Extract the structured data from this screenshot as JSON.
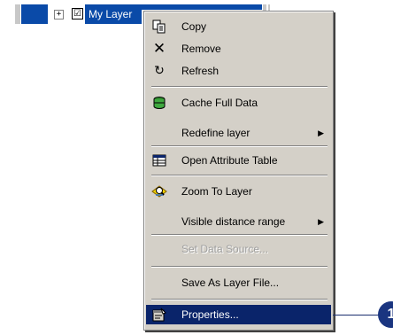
{
  "tree": {
    "expander": "+",
    "checkbox": "☑",
    "layer_name": "My Layer"
  },
  "menu": {
    "items": [
      {
        "label": "Copy",
        "icon": "copy-icon",
        "enabled": true
      },
      {
        "label": "Remove",
        "icon": "remove-x-icon",
        "enabled": true
      },
      {
        "label": "Refresh",
        "icon": "refresh-icon",
        "enabled": true
      },
      {
        "label": "Cache Full Data",
        "icon": "cache-database-icon",
        "enabled": true
      },
      {
        "label": "Redefine layer",
        "submenu": true,
        "enabled": true
      },
      {
        "label": "Open Attribute Table",
        "icon": "table-icon",
        "enabled": true
      },
      {
        "label": "Zoom To Layer",
        "icon": "zoom-layer-icon",
        "enabled": true
      },
      {
        "label": "Visible distance range",
        "submenu": true,
        "enabled": true
      },
      {
        "label": "Set Data Source...",
        "enabled": false
      },
      {
        "label": "Save As Layer File...",
        "enabled": true
      },
      {
        "label": "Properties...",
        "icon": "properties-icon",
        "enabled": true,
        "highlighted": true
      }
    ],
    "submenu_arrow": "▶"
  },
  "callout": {
    "number": "1"
  },
  "colors": {
    "selection_blue": "#0a4aa8",
    "menu_bg": "#d4d0c8",
    "highlight": "#0a246a",
    "callout": "#1a3580"
  }
}
